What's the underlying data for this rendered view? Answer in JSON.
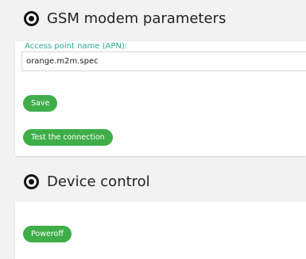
{
  "gsm": {
    "title": "GSM modem parameters",
    "apn_label": "Access point name (APN):",
    "apn_value": "orange.m2m.spec",
    "save_label": "Save",
    "test_label": "Test the connection"
  },
  "device": {
    "title": "Device control",
    "poweroff_label": "Poweroff"
  }
}
